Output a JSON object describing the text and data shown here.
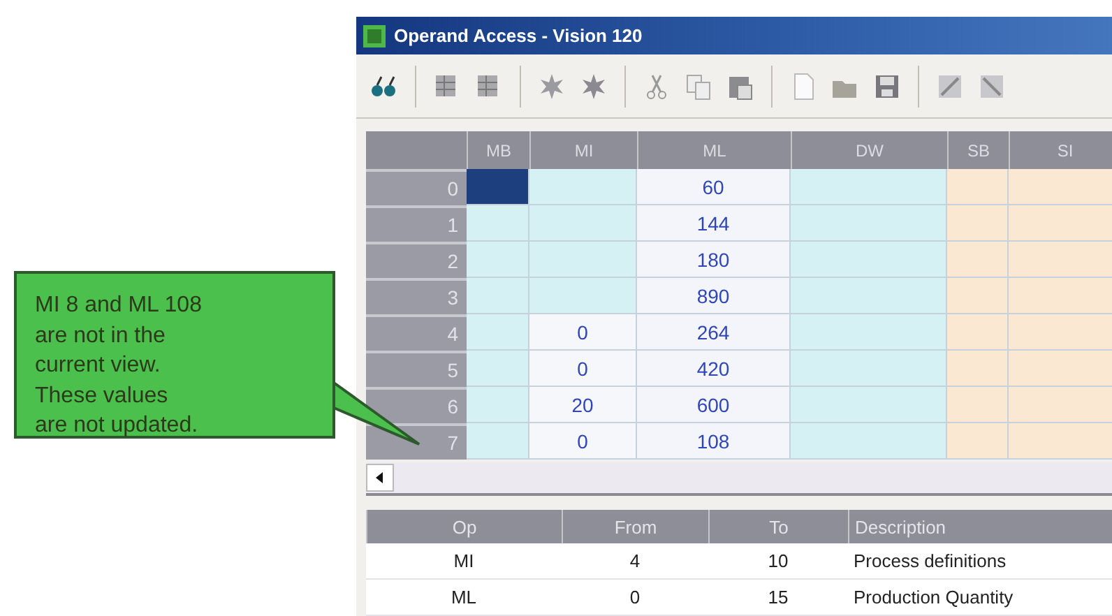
{
  "window": {
    "title": "Operand Access - Vision 120"
  },
  "grid": {
    "columns": [
      "MB",
      "MI",
      "ML",
      "DW",
      "SB",
      "SI"
    ],
    "rows": [
      {
        "header": "0",
        "cells": [
          {
            "selected": true
          },
          {
            "selected": false
          },
          {
            "value": "60",
            "selected": false
          },
          {
            "selected": false
          },
          {
            "selected": false
          },
          {
            "selected": false
          }
        ]
      },
      {
        "header": "1",
        "cells": [
          {
            "selected": false
          },
          {
            "selected": false
          },
          {
            "value": "144",
            "selected": false
          },
          {
            "selected": false
          },
          {
            "selected": false
          },
          {
            "selected": false
          }
        ]
      },
      {
        "header": "2",
        "cells": [
          {
            "selected": false
          },
          {
            "selected": false
          },
          {
            "value": "180",
            "selected": false
          },
          {
            "selected": false
          },
          {
            "selected": false
          },
          {
            "selected": false
          }
        ]
      },
      {
        "header": "3",
        "cells": [
          {
            "selected": false
          },
          {
            "selected": false
          },
          {
            "value": "890",
            "selected": false
          },
          {
            "selected": false
          },
          {
            "selected": false
          },
          {
            "selected": false
          }
        ]
      },
      {
        "header": "4",
        "cells": [
          {
            "selected": false
          },
          {
            "value": "0",
            "selected": false
          },
          {
            "value": "264",
            "selected": false
          },
          {
            "selected": false
          },
          {
            "selected": false
          },
          {
            "selected": false
          }
        ]
      },
      {
        "header": "5",
        "cells": [
          {
            "selected": false
          },
          {
            "value": "0",
            "selected": false
          },
          {
            "value": "420",
            "selected": false
          },
          {
            "selected": false
          },
          {
            "selected": false
          },
          {
            "selected": false
          }
        ]
      },
      {
        "header": "6",
        "cells": [
          {
            "selected": false
          },
          {
            "value": "20",
            "selected": false
          },
          {
            "value": "600",
            "selected": false
          },
          {
            "selected": false
          },
          {
            "selected": false
          },
          {
            "selected": false
          }
        ]
      },
      {
        "header": "7",
        "cells": [
          {
            "selected": false
          },
          {
            "value": "0",
            "selected": false
          },
          {
            "value": "108",
            "selected": false
          },
          {
            "selected": false
          },
          {
            "selected": false
          },
          {
            "selected": false
          }
        ]
      }
    ]
  },
  "ranges": {
    "columns": [
      "Op",
      "From",
      "To",
      "Description"
    ],
    "rows": [
      [
        "MI",
        "4",
        "10",
        "Process definitions"
      ],
      [
        "ML",
        "0",
        "15",
        "Production Quantity"
      ]
    ]
  },
  "callout": {
    "lines": [
      "MI 8 and ML 108",
      "are not in the",
      "current view.",
      "These values",
      "are not updated."
    ]
  }
}
